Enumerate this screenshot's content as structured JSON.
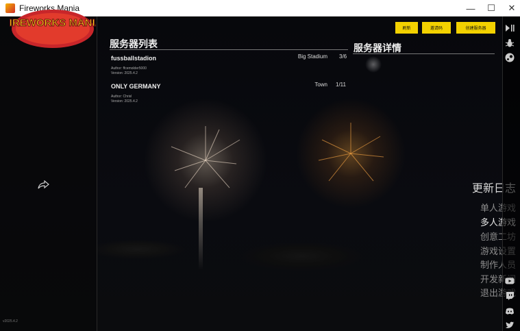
{
  "window": {
    "title": "Fireworks Mania"
  },
  "window_controls": {
    "minimize": "—",
    "maximize": "☐",
    "close": "✕"
  },
  "sidebar": {
    "logo": "FIREWORKS MANIA",
    "update_log": "更新日志",
    "menu": [
      {
        "label": "单人游戏"
      },
      {
        "label": "多人游戏"
      },
      {
        "label": "创意工坊"
      },
      {
        "label": "游戏设置"
      },
      {
        "label": "制作人员"
      },
      {
        "label": "开发新闻"
      },
      {
        "label": "退出游戏"
      }
    ],
    "version": "v2025.4.2"
  },
  "server_list": {
    "title": "服务器列表",
    "servers": [
      {
        "name": "fussballstadion",
        "map": "Big Stadium",
        "players": "3/6",
        "author": "Author: ffcemolder5000",
        "version": "Version: 2025.4.2"
      },
      {
        "name": "ONLY GERMANY",
        "map": "Town",
        "players": "1/11",
        "author": "Author: Chrisl",
        "version": "Version: 2025.4.2"
      }
    ]
  },
  "server_details": {
    "title": "服务器详情"
  },
  "buttons": {
    "refresh": "刷新",
    "invite_code": "邀请码",
    "create_server": "创建服务器"
  },
  "right_icons": [
    "play-pause-icon",
    "bug-icon",
    "steam-icon",
    "youtube-icon",
    "twitch-icon",
    "discord-icon",
    "twitter-icon"
  ],
  "colors": {
    "accent": "#f3d100"
  }
}
